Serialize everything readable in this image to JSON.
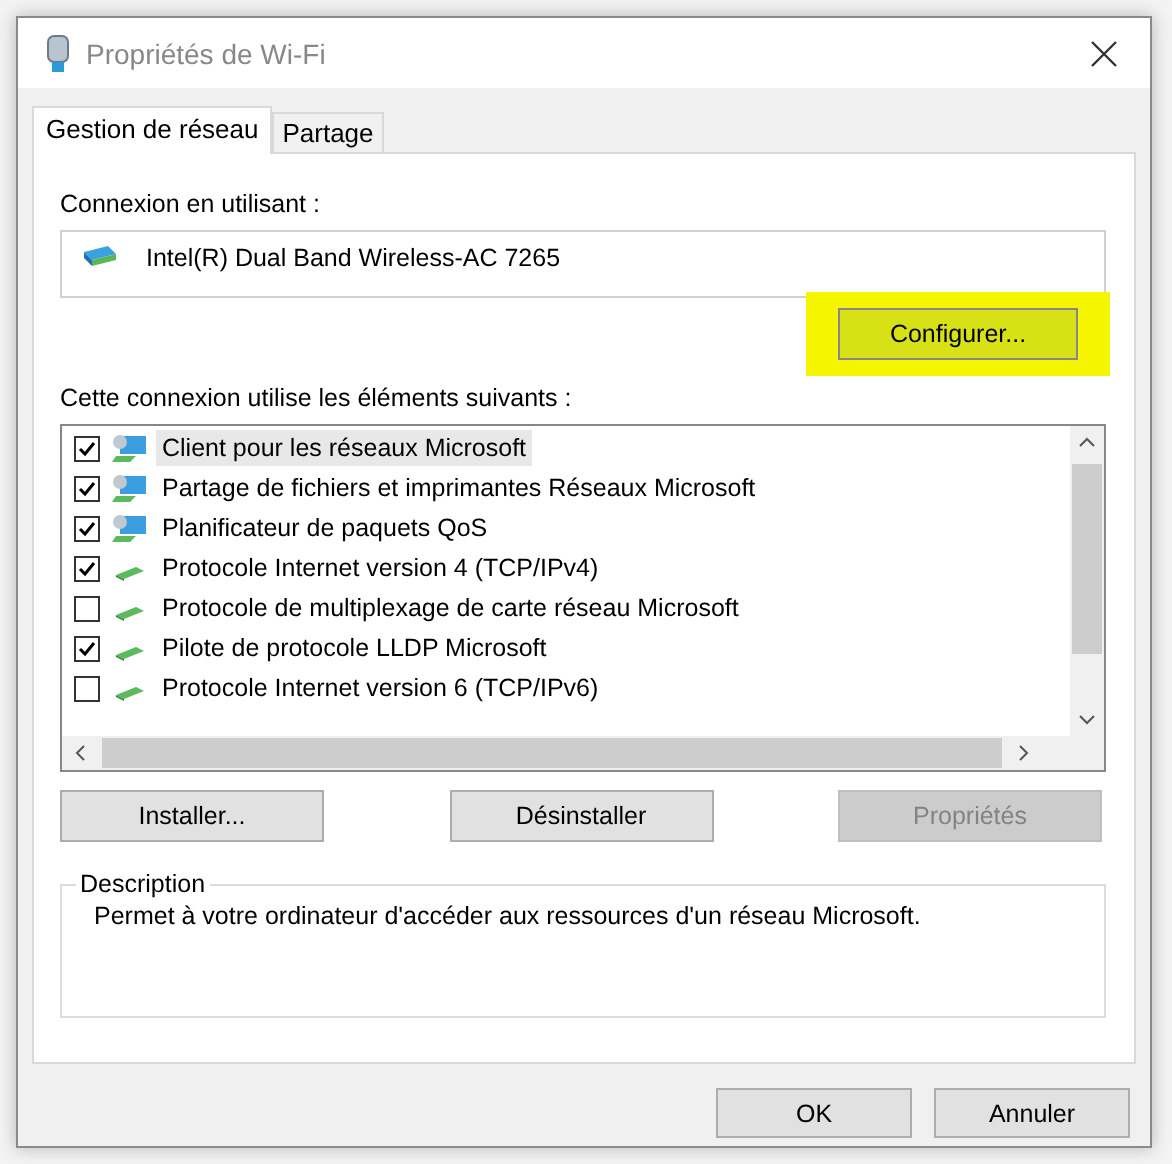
{
  "window": {
    "title": "Propriétés de Wi-Fi"
  },
  "tabs": [
    {
      "label": "Gestion de réseau",
      "selected": true
    },
    {
      "label": "Partage",
      "selected": false
    }
  ],
  "connection": {
    "label": "Connexion en utilisant :",
    "adapter": "Intel(R) Dual Band Wireless-AC 7265",
    "configure_button": "Configurer...",
    "configure_highlighted": true
  },
  "components": {
    "label": "Cette connexion utilise les éléments suivants :",
    "items": [
      {
        "label": "Client pour les réseaux Microsoft",
        "checked": true,
        "selected": true,
        "kind": "computer"
      },
      {
        "label": "Partage de fichiers et imprimantes Réseaux Microsoft",
        "checked": true,
        "selected": false,
        "kind": "computer"
      },
      {
        "label": "Planificateur de paquets QoS",
        "checked": true,
        "selected": false,
        "kind": "computer"
      },
      {
        "label": "Protocole Internet version 4 (TCP/IPv4)",
        "checked": true,
        "selected": false,
        "kind": "protocol"
      },
      {
        "label": "Protocole de multiplexage de carte réseau Microsoft",
        "checked": false,
        "selected": false,
        "kind": "protocol"
      },
      {
        "label": "Pilote de protocole LLDP Microsoft",
        "checked": true,
        "selected": false,
        "kind": "protocol"
      },
      {
        "label": "Protocole Internet version 6 (TCP/IPv6)",
        "checked": false,
        "selected": false,
        "kind": "protocol"
      }
    ]
  },
  "buttons": [
    {
      "label": "Installer...",
      "disabled": false
    },
    {
      "label": "Désinstaller",
      "disabled": false
    },
    {
      "label": "Propriétés",
      "disabled": true
    }
  ],
  "description": {
    "title": "Description",
    "text": "Permet à votre ordinateur d'accéder aux ressources d'un réseau Microsoft."
  },
  "footer_buttons": [
    "OK",
    "Annuler"
  ]
}
